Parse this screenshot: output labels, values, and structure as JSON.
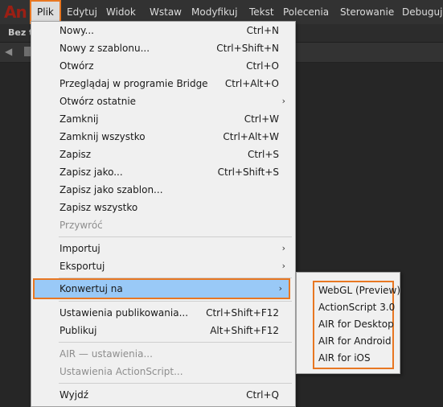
{
  "menubar": {
    "logo": "An",
    "items": [
      {
        "label": "Plik"
      },
      {
        "label": "Edytuj"
      },
      {
        "label": "Widok"
      },
      {
        "label": "Wstaw"
      },
      {
        "label": "Modyfikuj"
      },
      {
        "label": "Tekst"
      },
      {
        "label": "Polecenia"
      },
      {
        "label": "Sterowanie"
      },
      {
        "label": "Debuguj"
      }
    ]
  },
  "document_tab": "Bez ty",
  "file_menu": {
    "items": [
      {
        "label": "Nowy...",
        "shortcut": "Ctrl+N"
      },
      {
        "label": "Nowy z szablonu...",
        "shortcut": "Ctrl+Shift+N"
      },
      {
        "label": "Otwórz",
        "shortcut": "Ctrl+O"
      },
      {
        "label": "Przeglądaj w programie Bridge",
        "shortcut": "Ctrl+Alt+O"
      },
      {
        "label": "Otwórz ostatnie",
        "submenu": true
      },
      {
        "label": "Zamknij",
        "shortcut": "Ctrl+W"
      },
      {
        "label": "Zamknij wszystko",
        "shortcut": "Ctrl+Alt+W"
      },
      {
        "label": "Zapisz",
        "shortcut": "Ctrl+S"
      },
      {
        "label": "Zapisz jako...",
        "shortcut": "Ctrl+Shift+S"
      },
      {
        "label": "Zapisz jako szablon..."
      },
      {
        "label": "Zapisz wszystko"
      },
      {
        "label": "Przywróć",
        "disabled": true
      },
      {
        "label": "Importuj",
        "submenu": true
      },
      {
        "label": "Eksportuj",
        "submenu": true
      },
      {
        "label": "Konwertuj na",
        "submenu": true,
        "highlighted": true
      },
      {
        "label": "Ustawienia publikowania...",
        "shortcut": "Ctrl+Shift+F12"
      },
      {
        "label": "Publikuj",
        "shortcut": "Alt+Shift+F12"
      },
      {
        "label": "AIR — ustawienia...",
        "disabled": true
      },
      {
        "label": "Ustawienia ActionScript...",
        "disabled": true
      },
      {
        "label": "Wyjdź",
        "shortcut": "Ctrl+Q"
      }
    ],
    "submenu_arrow": "›"
  },
  "convert_submenu": {
    "items": [
      {
        "label": "WebGL (Preview)"
      },
      {
        "label": "ActionScript 3.0"
      },
      {
        "label": "AIR for Desktop"
      },
      {
        "label": "AIR for Android"
      },
      {
        "label": "AIR for iOS"
      }
    ]
  },
  "colors": {
    "highlight_outline": "#e87722",
    "menu_highlight": "#99c9f7",
    "menu_background": "#f0f0f0",
    "app_background": "#262626"
  }
}
